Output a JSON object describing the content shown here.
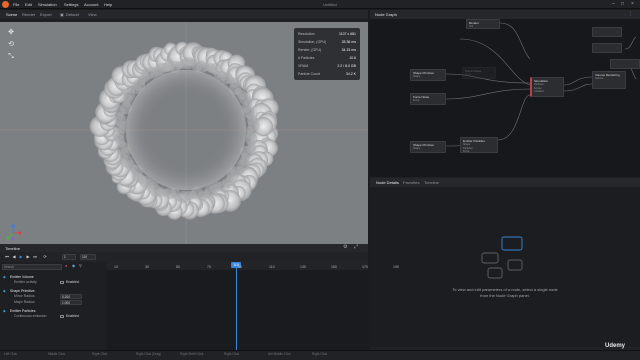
{
  "menubar": {
    "items": [
      "File",
      "Edit",
      "Simulation",
      "Settings",
      "Account",
      "Help"
    ],
    "window_title": "Untitled",
    "controls": [
      "–",
      "□",
      "×"
    ]
  },
  "viewport_tabs": [
    "Scene",
    "Render",
    "Export"
  ],
  "viewport_toolbar": {
    "shading": "Default",
    "view": "View"
  },
  "stats": [
    {
      "k": "Resolution",
      "v": "1107 x 681"
    },
    {
      "k": "Simulation, (GPU)",
      "v": "28.36 ms"
    },
    {
      "k": "Render, (GPU)",
      "v": "34.15 ms"
    },
    {
      "k": "# Particles",
      "v": "10.6"
    },
    {
      "k": "VRAM",
      "v": "2.2 / 8.0 GB"
    },
    {
      "k": "Particle Count",
      "v": "34.2 K"
    }
  ],
  "node_graph": {
    "title": "Node Graph",
    "nodes": [
      {
        "id": "shape-prim-1",
        "title": "Shape Primitive",
        "rows": [
          "Shape"
        ]
      },
      {
        "id": "force-noise-1",
        "title": "Force Noise",
        "rows": [
          "Force"
        ]
      },
      {
        "id": "force-noise-2",
        "title": "Force Noise",
        "rows": [
          "Force"
        ]
      },
      {
        "id": "shape-prim-2",
        "title": "Shape Primitive",
        "rows": [
          "Shape"
        ]
      },
      {
        "id": "emitter-particles",
        "title": "Emitter Particles",
        "rows": [
          "Shape",
          "Particles",
          "Force"
        ]
      },
      {
        "id": "simulation",
        "title": "Simulation",
        "rows": [
          "Particles",
          "Forces",
          "Colliders"
        ]
      },
      {
        "id": "volume-render",
        "title": "Volume Rendering",
        "rows": [
          "Volume"
        ]
      },
      {
        "id": "render",
        "title": "Render",
        "rows": [
          "Out"
        ]
      }
    ]
  },
  "detail_tabs": [
    "Node Details",
    "Favorites",
    "Timeline"
  ],
  "detail_message": "To view and edit parameters of a node, select a single node from the Node Graph panel.",
  "timeline": {
    "title": "Timeline",
    "frame_start": "1",
    "frame_current": "110",
    "ticks": [
      "10",
      "30",
      "50",
      "70",
      "90",
      "110",
      "130",
      "150",
      "170",
      "190"
    ],
    "playhead_value": "110",
    "search_placeholder": "Search",
    "tracks": [
      {
        "group": "Emitter Volume",
        "rows": [
          {
            "name": "Emitter activity",
            "value": "Enabled"
          }
        ]
      },
      {
        "group": "Shape Primitive",
        "rows": [
          {
            "name": "Minor Radius",
            "value": "0.200"
          },
          {
            "name": "Major Radius",
            "value": "1.000"
          }
        ]
      },
      {
        "group": "Emitter Particles",
        "rows": [
          {
            "name": "Continuous emission",
            "value": "Enabled"
          }
        ]
      }
    ]
  },
  "statusbar": [
    "Left Click",
    "Middle Click",
    "Right Click",
    "Right Click (Drag)",
    "Right Shift+Click",
    "Right Click",
    "Alt+Middle Click",
    "Right Click"
  ],
  "watermark": "Udemy",
  "colors": {
    "accent": "#3a86d9",
    "logo": "#e8672d",
    "sim_node": "#b8424a"
  }
}
